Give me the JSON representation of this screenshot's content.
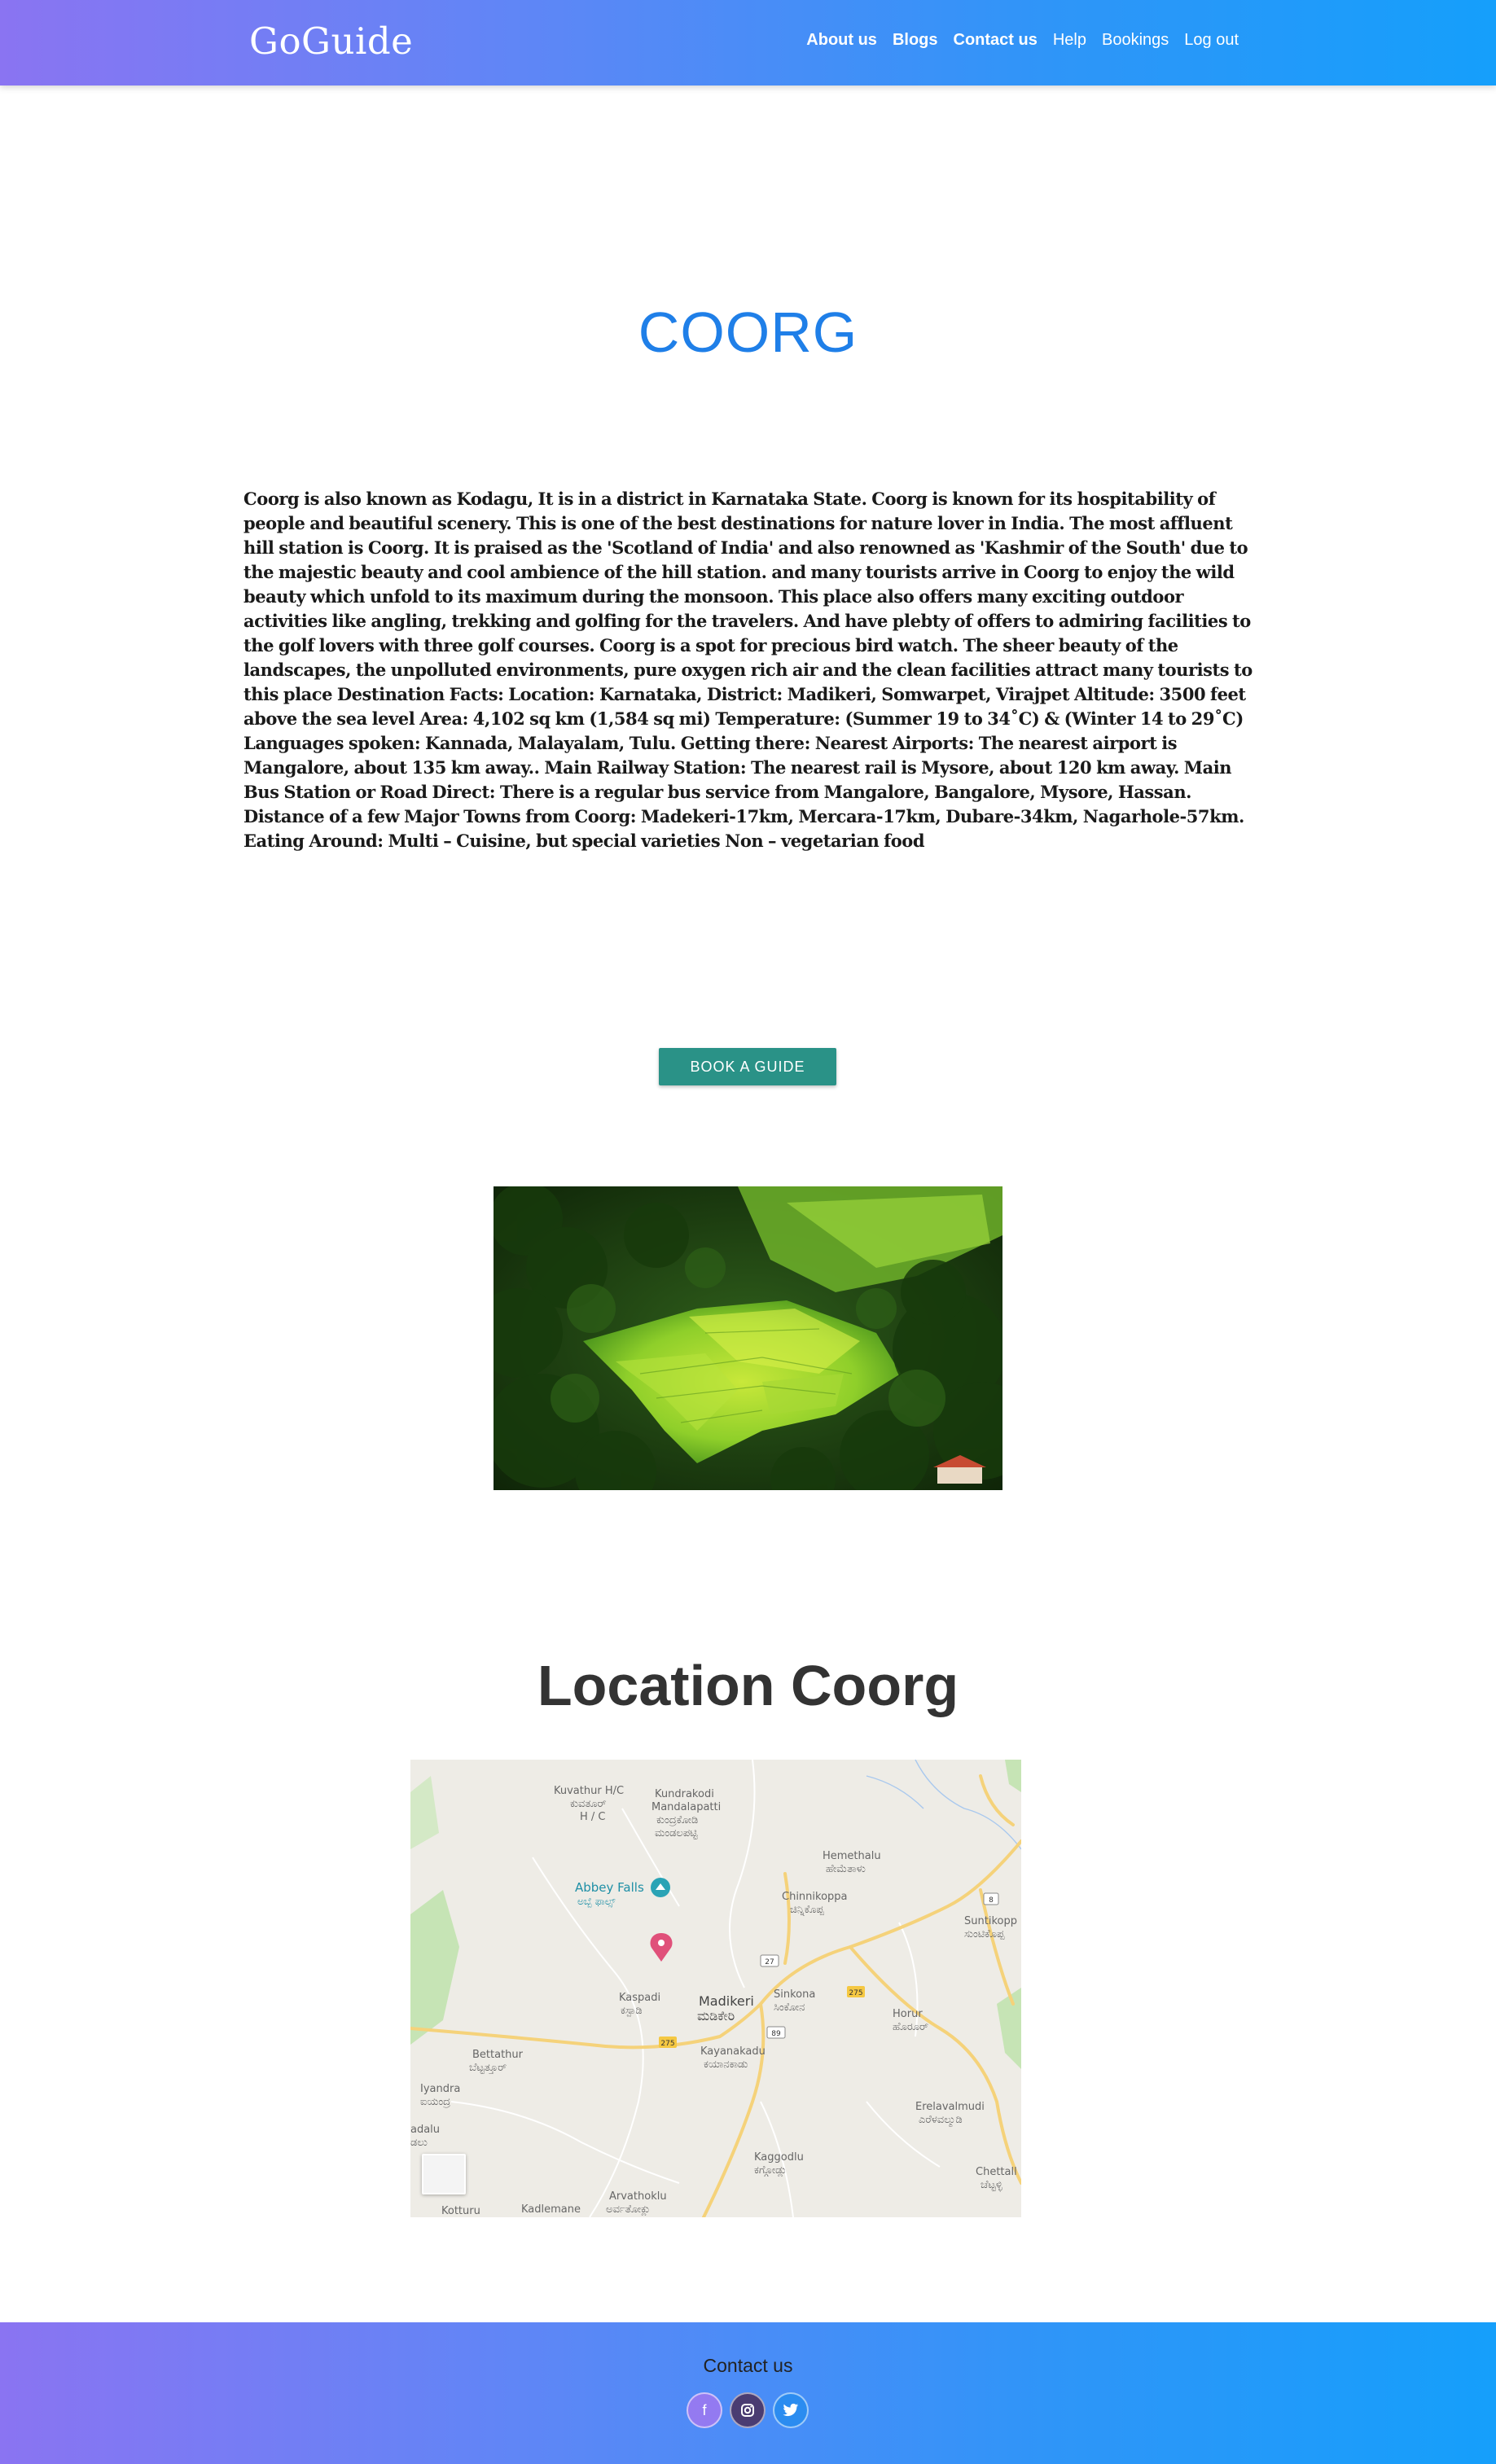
{
  "header": {
    "brand": "GoGuide",
    "nav": [
      {
        "label": "About us"
      },
      {
        "label": "Blogs"
      },
      {
        "label": "Contact us"
      },
      {
        "label": "Help"
      },
      {
        "label": "Bookings"
      },
      {
        "label": "Log out"
      }
    ]
  },
  "main": {
    "title": "COORG",
    "description": "Coorg is also known as Kodagu, It is in a district in Karnataka State. Coorg is known for its hospitability of people and beautiful scenery. This is one of the best destinations for nature lover in India. The most affluent hill station is Coorg. It is praised as the 'Scotland of India' and also renowned as 'Kashmir of the South' due to the majestic beauty and cool ambience of the hill station. and many tourists arrive in Coorg to enjoy the wild beauty which unfold to its maximum during the monsoon. This place also offers many exciting outdoor activities like angling, trekking and golfing for the travelers. And have plebty of offers to admiring facilities to the golf lovers with three golf courses. Coorg is a spot for precious bird watch. The sheer beauty of the landscapes, the unpolluted environments, pure oxygen rich air and the clean facilities attract many tourists to this place Destination Facts: Location: Karnataka, District: Madikeri, Somwarpet, Virajpet Altitude: 3500 feet above the sea level Area: 4,102 sq km (1,584 sq mi) Temperature: (Summer 19 to 34˚C) & (Winter 14 to 29˚C) Languages spoken: Kannada, Malayalam, Tulu. Getting there: Nearest Airports: The nearest airport is Mangalore, about 135 km away.. Main Railway Station: The nearest rail is Mysore, about 120 km away. Main Bus Station or Road Direct: There is a regular bus service from Mangalore, Bangalore, Mysore, Hassan. Distance of a few Major Towns from Coorg: Madekeri-17km, Mercara-17km, Dubare-34km, Nagarhole-57km. Eating Around: Multi – Cuisine, but special varieties Non – vegetarian food",
    "book_button": "BOOK A GUIDE"
  },
  "location": {
    "title": "Location Coorg",
    "map_labels": {
      "kuvathur": "Kuvathur H/C",
      "kuvathur_kn": "ಕುವತೂರ್",
      "kuvathur_hc": "H / C",
      "kundrakodi": "Kundrakodi",
      "mandalapatti": "Mandalapatti",
      "kundrakodi_kn": "ಕುಂದ್ರಕೋಡಿ",
      "mandalapatti_kn": "ಮಂಡಲಪಟ್ಟಿ",
      "abbey_falls": "Abbey Falls",
      "abbey_falls_kn": "ಅಬ್ಬೆ ಫಾಲ್ಸ್",
      "hemethalu": "Hemethalu",
      "hemethalu_kn": "ಹೇಮೆತಾಳು",
      "chinnikoppa": "Chinnikoppa",
      "chinnikoppa_kn": "ಚಿನ್ನಿಕೊಪ್ಪ",
      "suntikopp": "Suntikopp",
      "suntikopp_kn": "ಸುಂಟಿಕೊಪ್ಪ",
      "kaspadi": "Kaspadi",
      "kaspadi_kn": "ಕಸ್ಪಾಡಿ",
      "madikeri": "Madikeri",
      "madikeri_kn": "ಮಡಿಕೇರಿ",
      "sinkona": "Sinkona",
      "sinkona_kn": "ಸಿಂಕೋನ",
      "horur": "Horur",
      "horur_kn": "ಹೊರೂರ್",
      "bettathur": "Bettathur",
      "bettathur_kn": "ಬೆಟ್ಟತ್ತೂರ್",
      "kayanakadu": "Kayanakadu",
      "kayanakadu_kn": "ಕಯಾನಕಾಡು",
      "iyandra": "Iyandra",
      "iyandra_kn": "ಐಯಂದ್ರ",
      "adalu": "adalu",
      "adalu_kn": "ಡಲು",
      "erelavalmudi": "Erelavalmudi",
      "erelavalmudi_kn": "ಎರೆಳವಲ್ಮುಡಿ",
      "kaggodlu": "Kaggodlu",
      "kaggodlu_kn": "ಕಗ್ಗೋಡ್ಲು",
      "chettall": "Chettall",
      "chettall_kn": "ಚೆಟ್ಟಳ್ಳಿ",
      "arvathoklu": "Arvathoklu",
      "arvathoklu_kn": "ಅರ್ವತೋಕ್ಲು",
      "kotturu": "Kotturu",
      "kadlemane": "Kadlemane",
      "road_27": "27",
      "road_275a": "275",
      "road_275b": "275",
      "road_89": "89",
      "road_8": "8"
    }
  },
  "footer": {
    "title": "Contact us",
    "social": [
      {
        "name": "facebook",
        "glyph": "f"
      },
      {
        "name": "instagram",
        "glyph": "◙"
      },
      {
        "name": "twitter",
        "glyph": "🐦"
      }
    ]
  },
  "colors": {
    "gradient_start": "#8a74f2",
    "gradient_end": "#159ffb",
    "title_blue": "#1f7fe8",
    "button_teal": "#2a9287"
  }
}
